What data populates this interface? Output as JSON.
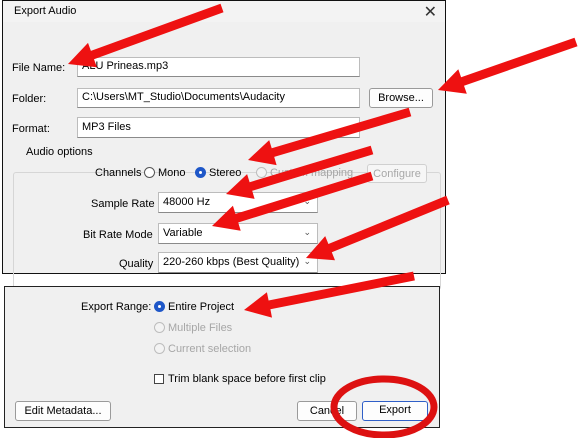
{
  "dialog": {
    "title": "Export Audio",
    "close_glyph": "✕",
    "file_name_label": "File Name:",
    "file_name_value": "ALU Prineas.mp3",
    "folder_label": "Folder:",
    "folder_value": "C:\\Users\\MT_Studio\\Documents\\Audacity",
    "browse_label": "Browse...",
    "format_label": "Format:",
    "format_value": "MP3 Files",
    "audio_options": {
      "group_label": "Audio options",
      "channels_label": "Channels",
      "mono_label": "Mono",
      "stereo_label": "Stereo",
      "custom_mapping_label": "Custom mapping",
      "configure_label": "Configure",
      "selected_channel": "Stereo",
      "sample_rate_label": "Sample Rate",
      "sample_rate_value": "48000 Hz",
      "bit_rate_mode_label": "Bit Rate Mode",
      "bit_rate_mode_value": "Variable",
      "quality_label": "Quality",
      "quality_value": "220-260 kbps (Best Quality)"
    },
    "export_range": {
      "label": "Export Range:",
      "entire_project": "Entire Project",
      "multiple_files": "Multiple Files",
      "current_selection": "Current selection",
      "selected": "Entire Project"
    },
    "trim_label": "Trim blank space before first clip",
    "trim_checked": false,
    "edit_metadata_label": "Edit Metadata...",
    "cancel_label": "Cancel",
    "export_label": "Export"
  },
  "annotation": {
    "arrow_color": "#ee1111",
    "circle_color": "#dd1111"
  }
}
